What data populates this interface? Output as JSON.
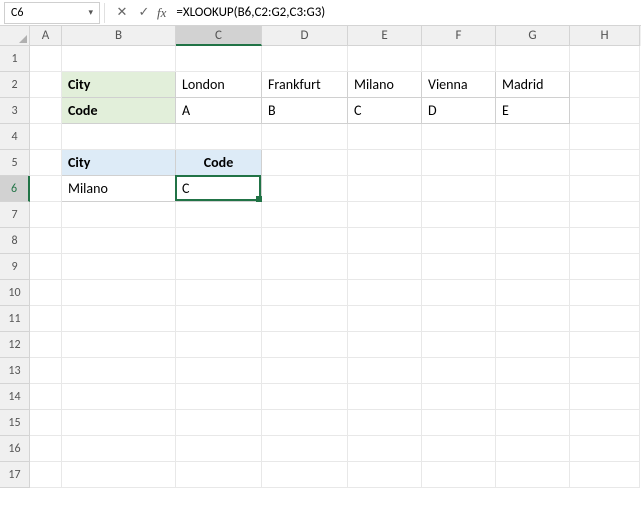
{
  "name_box": "C6",
  "formula": "=XLOOKUP(B6,C2:G2,C3:G3)",
  "columns": [
    "A",
    "B",
    "C",
    "D",
    "E",
    "F",
    "G",
    "H"
  ],
  "active_col": "C",
  "rows": [
    "1",
    "2",
    "3",
    "4",
    "5",
    "6",
    "7",
    "8",
    "9",
    "10",
    "11",
    "12",
    "13",
    "14",
    "15",
    "16",
    "17"
  ],
  "active_row": "6",
  "table1": {
    "header_city": "City",
    "header_code": "Code",
    "cities": [
      "London",
      "Frankfurt",
      "Milano",
      "Vienna",
      "Madrid"
    ],
    "codes": [
      "A",
      "B",
      "C",
      "D",
      "E"
    ]
  },
  "lookup": {
    "header_city": "City",
    "header_code": "Code",
    "city_value": "Milano",
    "code_value": "C"
  }
}
